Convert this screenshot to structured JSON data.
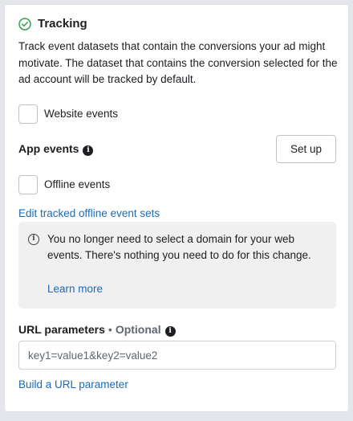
{
  "tracking": {
    "title": "Tracking",
    "title_icon": "check-circle-icon",
    "description": "Track event datasets that contain the conversions your ad might motivate. The dataset that contains the conversion selected for the ad account will be tracked by default."
  },
  "website_events": {
    "label": "Website events",
    "checked": false
  },
  "app_events": {
    "label": "App events",
    "info_icon": "info-icon",
    "setup_label": "Set up"
  },
  "offline_events": {
    "label": "Offline events",
    "checked": false
  },
  "edit_link": "Edit tracked offline event sets",
  "notice": {
    "icon": "info-outline-icon",
    "text": "You no longer need to select a domain for your web events. There's nothing you need to do for this change.",
    "link": "Learn more"
  },
  "url_parameters": {
    "label": "URL parameters",
    "separator": "•",
    "optional": "Optional",
    "info_icon": "info-icon",
    "placeholder": "key1=value1&key2=value2",
    "value": "",
    "build_link": "Build a URL parameter"
  },
  "colors": {
    "link": "#1a6bb8",
    "check_icon": "#31a24c",
    "notice_bg": "#f0f0f0"
  }
}
